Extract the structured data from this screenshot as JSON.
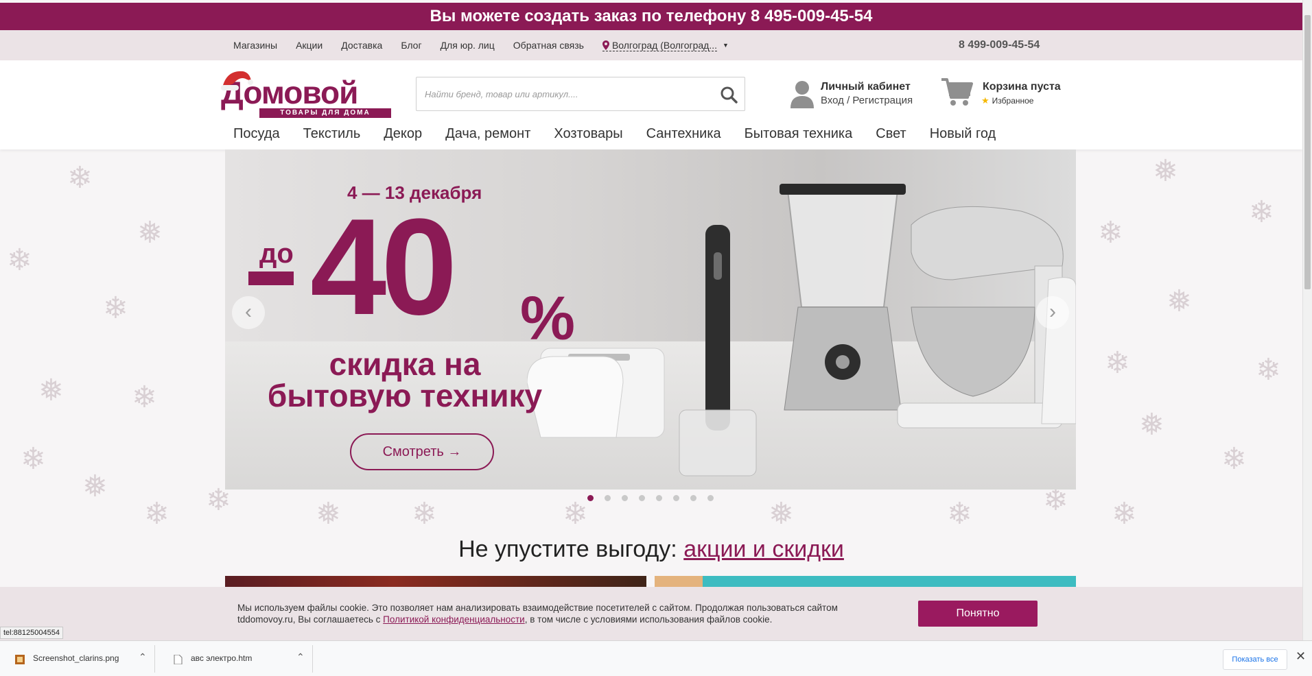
{
  "promo_bar": {
    "text": "Вы можете создать заказ по телефону",
    "phone": "8 495-009-45-54"
  },
  "util_bar": {
    "links": [
      "Магазины",
      "Акции",
      "Доставка",
      "Блог",
      "Для юр. лиц",
      "Обратная связь"
    ],
    "city": "Волгоград (Волгоград...",
    "phone": "8 499-009-45-54"
  },
  "header": {
    "logo_word": "Домовой",
    "logo_sub": "ТОВАРЫ ДЛЯ ДОМА",
    "search_placeholder": "Найти бренд, товар или артикул....",
    "account_title": "Личный кабинет",
    "account_sub": "Вход / Регистрация",
    "cart_title": "Корзина пуста",
    "favorites": "Избранное"
  },
  "nav": [
    "Посуда",
    "Текстиль",
    "Декор",
    "Дача, ремонт",
    "Хозтовары",
    "Сантехника",
    "Бытовая техника",
    "Свет",
    "Новый год"
  ],
  "slider": {
    "dates": "4 — 13 декабря",
    "upto": "до",
    "discount": "40",
    "percent": "%",
    "line1": "скидка на",
    "line2": "бытовую технику",
    "cta": "Смотреть →",
    "prev": "‹",
    "next": "›",
    "dots_count": 8,
    "active_dot": 0
  },
  "deals": {
    "text": "Не упустите выгоду:",
    "link": "акции и скидки"
  },
  "cookie": {
    "text_before": "Мы используем файлы cookie. Это позволяет нам анализировать взаимодействие посетителей с сайтом. Продолжая пользоваться сайтом tddomovoy.ru, Вы соглашаетесь с",
    "link": "Политикой конфиденциальности",
    "text_after": ", в том числе с условиями использования файлов cookie.",
    "button": "Понятно"
  },
  "status_url": "tel:88125004554",
  "downloads": {
    "items": [
      "Screenshot_clarins.png",
      "авс электро.htm"
    ],
    "show_all": "Показать все",
    "close": "✕"
  },
  "colors": {
    "brand": "#8b1a55",
    "util_bg": "#ebe3e6"
  }
}
